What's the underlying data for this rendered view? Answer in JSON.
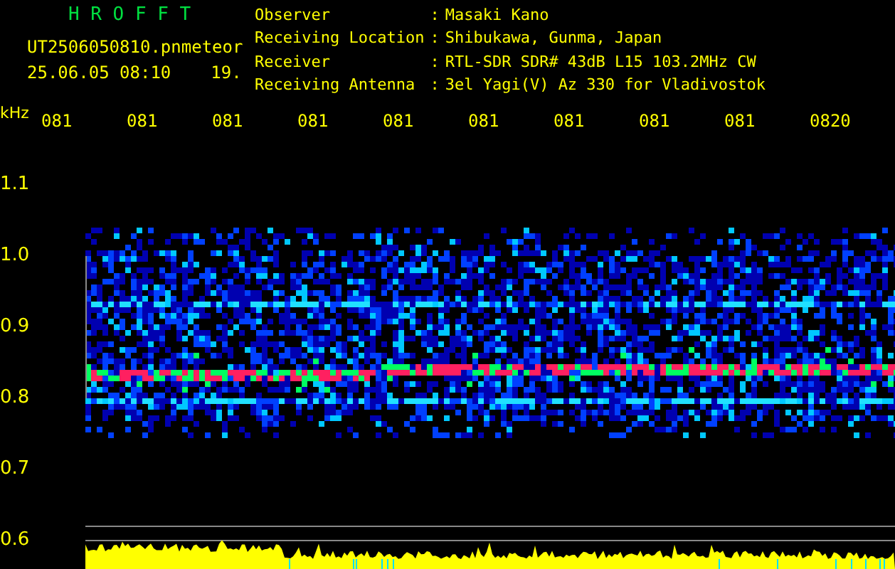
{
  "header": {
    "title": "H R O F F T",
    "filename": "UT2506050810.pn",
    "mode": "meteor",
    "timestamp": "25.06.05 08:10",
    "count": "19."
  },
  "station": [
    {
      "label": "Observer",
      "separator": ":",
      "value": "Masaki Kano"
    },
    {
      "label": "Receiving Location",
      "separator": ":",
      "value": "Shibukawa, Gunma, Japan"
    },
    {
      "label": "Receiver",
      "separator": ":",
      "value": "RTL-SDR SDR# 43dB L15 103.2MHz CW"
    },
    {
      "label": "Receiving Antenna",
      "separator": ":",
      "value": "3el Yagi(V) Az 330 for Vladivostok"
    }
  ],
  "y_axis": {
    "unit": "kHz",
    "ticks": [
      "1.1",
      "1.0",
      "0.9",
      "0.8",
      "0.7",
      "0.6"
    ]
  },
  "time_labels": [
    "081",
    "081",
    "081",
    "081",
    "081",
    "081",
    "081",
    "081",
    "081",
    "0820"
  ]
}
